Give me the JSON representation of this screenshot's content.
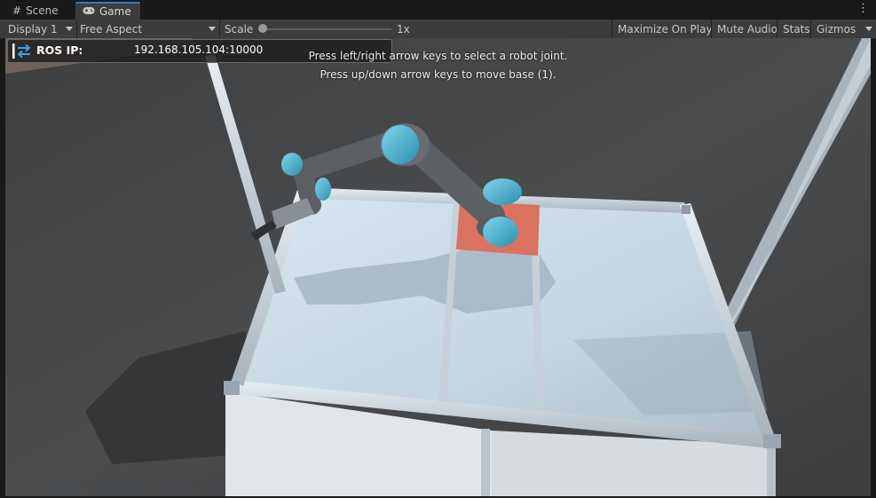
{
  "tabs": [
    {
      "label": "Scene",
      "icon": "grid-icon"
    },
    {
      "label": "Game",
      "icon": "gamepad-icon"
    }
  ],
  "toolbar": {
    "display_label": "Display 1",
    "aspect_label": "Free Aspect",
    "scale_label": "Scale",
    "scale_value": "1x",
    "maximize_label": "Maximize On Play",
    "mute_label": "Mute Audio",
    "stats_label": "Stats",
    "gizmos_label": "Gizmos"
  },
  "ros": {
    "label": "ROS IP:",
    "value": "192.168.105.104:10000",
    "icon": "ros-connection-icon"
  },
  "instructions": {
    "line1": "Press left/right arrow keys to select a robot joint.",
    "line2": "Press up/down arrow keys to move base (1)."
  },
  "colors": {
    "accent_tab": "#3a79bb",
    "robot_joint_cyan": "#4fb6d3",
    "robot_link_gray": "#5c5f63",
    "base_plate": "#d9725e"
  }
}
